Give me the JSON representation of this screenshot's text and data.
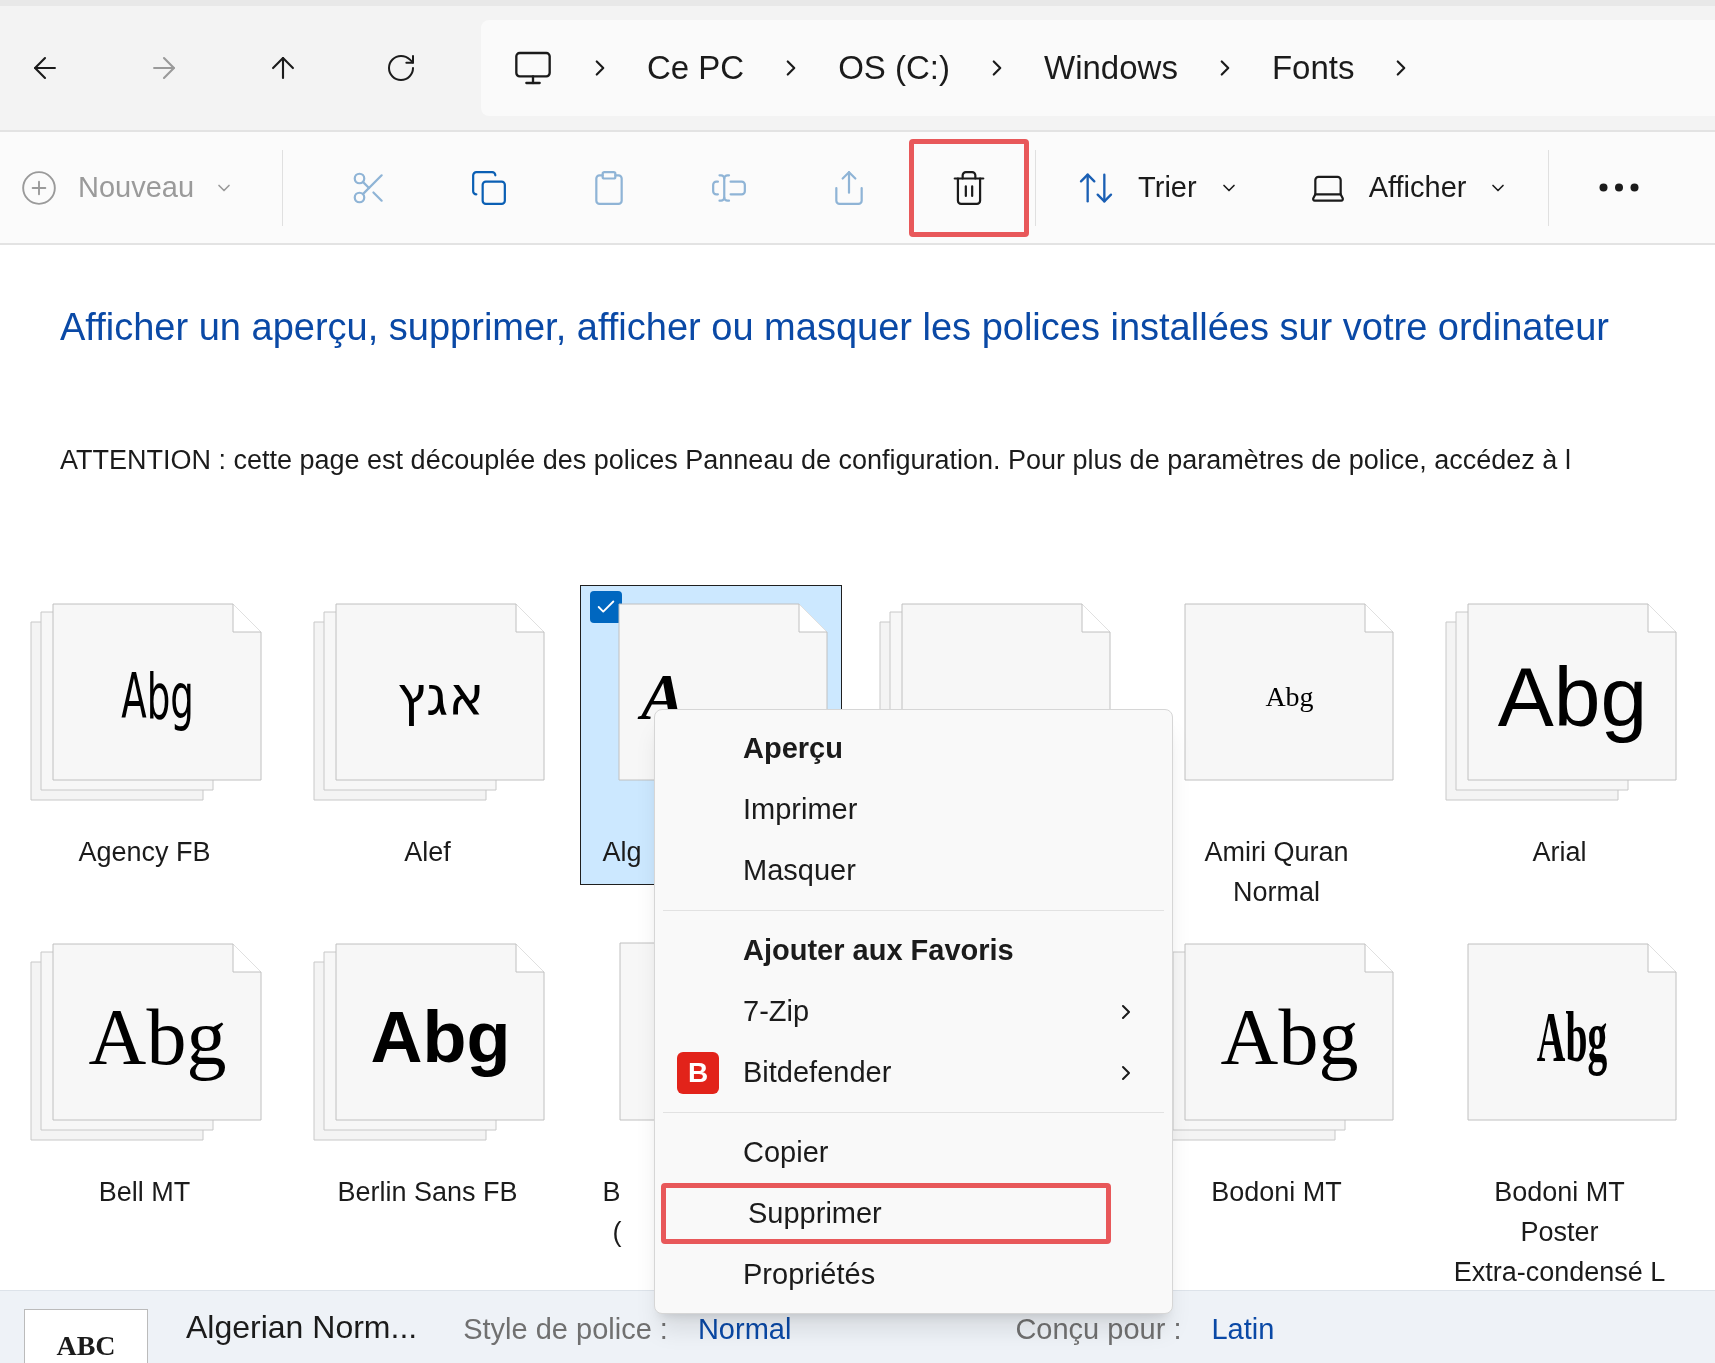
{
  "nav": {
    "back_disabled": false,
    "forward_disabled": true,
    "breadcrumb": [
      "Ce PC",
      "OS (C:)",
      "Windows",
      "Fonts"
    ]
  },
  "toolbar": {
    "new_label": "Nouveau",
    "new_disabled": true,
    "actions": [
      {
        "kind": "cut",
        "disabled": true,
        "highlighted": false
      },
      {
        "kind": "copy",
        "disabled": false,
        "highlighted": false
      },
      {
        "kind": "paste",
        "disabled": true,
        "highlighted": false
      },
      {
        "kind": "rename",
        "disabled": true,
        "highlighted": false
      },
      {
        "kind": "share",
        "disabled": true,
        "highlighted": false
      },
      {
        "kind": "delete",
        "disabled": false,
        "highlighted": true
      }
    ],
    "sort_label": "Trier",
    "view_label": "Afficher"
  },
  "title": "Afficher un aperçu, supprimer, afficher ou masquer les polices installées sur votre ordinateur",
  "notice": "ATTENTION : cette page est découplée des polices Panneau de configuration. Pour plus de paramètres de police, accédez à l",
  "fonts": [
    [
      {
        "kind": "condensed",
        "name": [
          "Agency FB"
        ],
        "preview": "Abg",
        "stacked": true,
        "covered": false,
        "selected": false
      },
      {
        "kind": "hebrew",
        "name": [
          "Alef"
        ],
        "preview": "אגץ",
        "stacked": true,
        "covered": false,
        "selected": false
      },
      {
        "kind": "decorative",
        "name": [
          "Alg"
        ],
        "preview": "A",
        "stacked": false,
        "covered": true,
        "selected": true
      },
      {
        "kind": "blank",
        "stacked": true,
        "selected": false
      },
      {
        "kind": "small-serif",
        "name": [
          "Amiri Quran",
          "Normal"
        ],
        "preview": "Abg",
        "stacked": false,
        "covered": false,
        "selected": false
      },
      {
        "kind": "sans",
        "name": [
          "Arial"
        ],
        "preview": "Abg",
        "stacked": true,
        "covered": false,
        "selected": false
      }
    ],
    [
      {
        "kind": "serif",
        "name": [
          "Bell MT"
        ],
        "preview": "Abg",
        "stacked": true,
        "covered": false,
        "selected": false
      },
      {
        "kind": "bold-sans",
        "name": [
          "Berlin Sans FB"
        ],
        "preview": "Abg",
        "stacked": true,
        "covered": false,
        "selected": false
      },
      {
        "kind": "blank",
        "name": [
          "B",
          "("
        ],
        "stacked": false,
        "covered": true,
        "selected": false
      },
      {
        "kind": "hidden"
      },
      {
        "kind": "serif",
        "name": [
          "Bodoni MT"
        ],
        "preview": "Abg",
        "stacked": true,
        "covered": false,
        "selected": false
      },
      {
        "kind": "poster",
        "name": [
          "Bodoni MT",
          "Poster",
          "Extra-condensé L"
        ],
        "preview": "Abg",
        "stacked": false,
        "covered": false,
        "selected": false
      }
    ]
  ],
  "context_menu": [
    {
      "kind": "item",
      "label": "Aperçu",
      "bold": true,
      "highlighted": false
    },
    {
      "kind": "item",
      "label": "Imprimer",
      "bold": false,
      "highlighted": false
    },
    {
      "kind": "item",
      "label": "Masquer",
      "bold": false,
      "highlighted": false
    },
    {
      "kind": "separator"
    },
    {
      "kind": "item",
      "label": "Ajouter aux Favoris",
      "bold": true,
      "highlighted": false
    },
    {
      "kind": "submenu",
      "label": "7-Zip"
    },
    {
      "kind": "submenu",
      "label": "Bitdefender",
      "badge": "B"
    },
    {
      "kind": "separator"
    },
    {
      "kind": "item",
      "label": "Copier",
      "bold": false,
      "highlighted": false
    },
    {
      "kind": "item",
      "label": "Supprimer",
      "bold": false,
      "highlighted": true
    },
    {
      "kind": "item",
      "label": "Propriétés",
      "bold": false,
      "highlighted": false
    }
  ],
  "details": {
    "thumbnail": "ABC",
    "name": "Algerian Norm...",
    "fields": [
      {
        "label": "Style de police :",
        "value": "Normal"
      },
      {
        "label": "Conçu pour :",
        "value": "Latin"
      }
    ]
  }
}
